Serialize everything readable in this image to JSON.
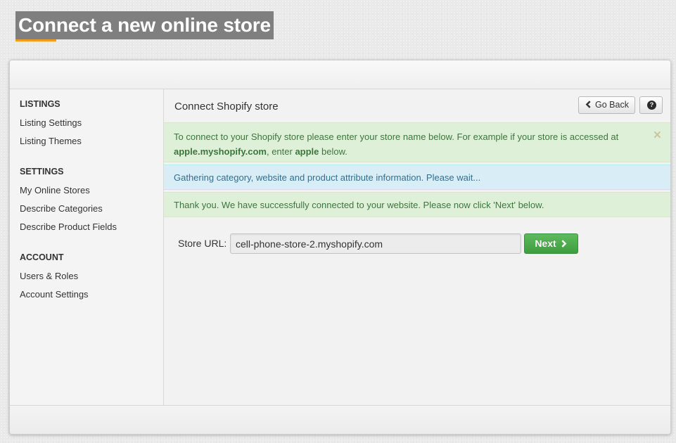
{
  "page": {
    "title": "Connect a new online store",
    "accent_color": "#f39a1f"
  },
  "sidebar": {
    "sections": [
      {
        "heading": "LISTINGS",
        "items": [
          "Listing Settings",
          "Listing Themes"
        ]
      },
      {
        "heading": "SETTINGS",
        "items": [
          "My Online Stores",
          "Describe Categories",
          "Describe Product Fields"
        ]
      },
      {
        "heading": "ACCOUNT",
        "items": [
          "Users & Roles",
          "Account Settings"
        ]
      }
    ]
  },
  "content": {
    "title": "Connect Shopify store",
    "back_button": "Go Back",
    "help_icon": "question-circle-icon",
    "alerts": {
      "instructions": {
        "part1": "To connect to your Shopify store please enter your store name below. For example if your store is accessed at ",
        "example_domain": "apple.myshopify.com",
        "part2": ", enter ",
        "example_name": "apple",
        "part3": " below.",
        "close": "×"
      },
      "progress": "Gathering category, website and product attribute information. Please wait...",
      "success": "Thank you. We have successfully connected to your website. Please now click 'Next' below."
    },
    "store_url": {
      "label": "Store URL:",
      "value": "cell-phone-store-2.myshopify.com"
    },
    "next_button": "Next"
  },
  "colors": {
    "success_bg": "#dff0d8",
    "success_text": "#3c763d",
    "info_bg": "#d9edf7",
    "info_text": "#31708f",
    "next_button": "#4cae4c",
    "title_bg": "#7f7f7f"
  }
}
